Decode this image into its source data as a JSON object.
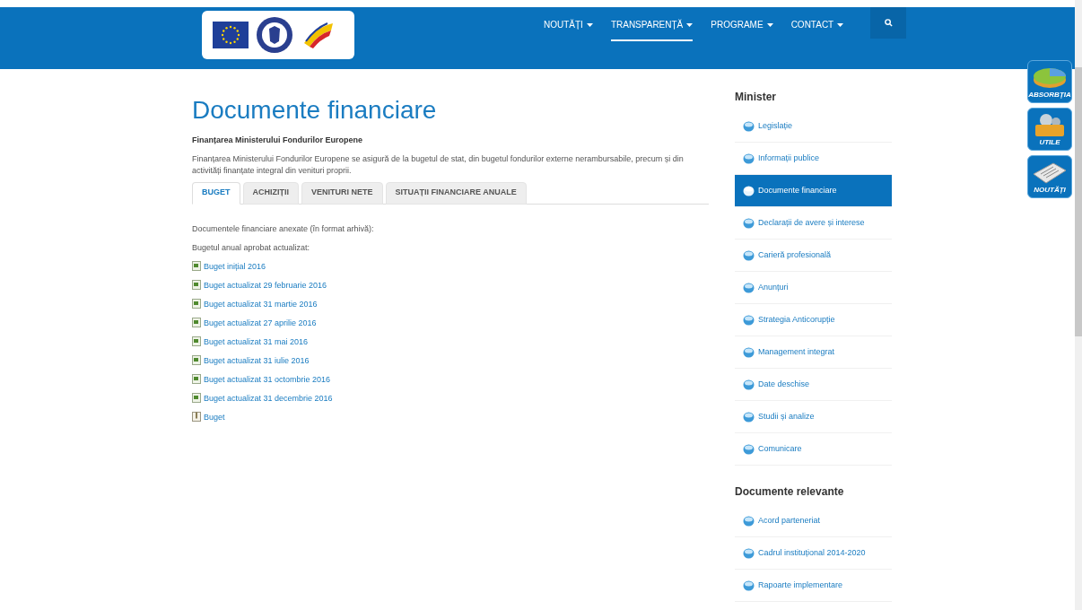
{
  "nav": [
    {
      "label": "NOUTĂȚI",
      "selected": false
    },
    {
      "label": "TRANSPARENȚĂ",
      "selected": true
    },
    {
      "label": "PROGRAME",
      "selected": false
    },
    {
      "label": "CONTACT",
      "selected": false
    }
  ],
  "title": "Documente financiare",
  "subtitle": "Finanțarea Ministerului Fondurilor Europene",
  "intro": "Finanțarea Ministerului Fondurilor Europene se asigură de la bugetul de stat, din bugetul fondurilor externe nerambursabile, precum și din activități finanțate integral din venituri proprii.",
  "tabs": [
    {
      "label": "BUGET",
      "selected": true
    },
    {
      "label": "ACHIZIȚII",
      "selected": false
    },
    {
      "label": "VENITURI NETE",
      "selected": false
    },
    {
      "label": "SITUAȚII FINANCIARE ANUALE",
      "selected": false
    }
  ],
  "notes": [
    "Documentele financiare anexate (în format arhivă):",
    "Bugetul anual aprobat actualizat:"
  ],
  "documents": [
    {
      "label": "Buget inițial 2016",
      "kind": "sheet"
    },
    {
      "label": "Buget actualizat 29 februarie 2016",
      "kind": "sheet"
    },
    {
      "label": "Buget actualizat 31 martie 2016",
      "kind": "sheet"
    },
    {
      "label": "Buget actualizat 27 aprilie 2016",
      "kind": "sheet"
    },
    {
      "label": "Buget actualizat 31 mai 2016",
      "kind": "sheet"
    },
    {
      "label": "Buget actualizat 31 iulie 2016",
      "kind": "sheet"
    },
    {
      "label": "Buget actualizat 31 octombrie 2016",
      "kind": "sheet"
    },
    {
      "label": "Buget actualizat 31 decembrie 2016",
      "kind": "sheet"
    },
    {
      "label": "Buget",
      "kind": "archive"
    }
  ],
  "sidebar": [
    {
      "heading": "Minister",
      "items": [
        {
          "label": "Legislație",
          "selected": false
        },
        {
          "label": "Informații publice",
          "selected": false
        },
        {
          "label": "Documente financiare",
          "selected": true
        },
        {
          "label": "Declarații de avere și interese",
          "selected": false
        },
        {
          "label": "Carieră profesională",
          "selected": false
        },
        {
          "label": "Anunțuri",
          "selected": false
        },
        {
          "label": "Strategia Anticorupție",
          "selected": false
        },
        {
          "label": "Management integrat",
          "selected": false
        },
        {
          "label": "Date deschise",
          "selected": false
        },
        {
          "label": "Studii și analize",
          "selected": false
        },
        {
          "label": "Comunicare",
          "selected": false
        }
      ]
    },
    {
      "heading": "Documente relevante",
      "items": [
        {
          "label": "Acord parteneriat",
          "selected": false
        },
        {
          "label": "Cadrul instituțional 2014-2020",
          "selected": false
        },
        {
          "label": "Rapoarte implementare",
          "selected": false
        }
      ]
    }
  ],
  "quick_links": [
    {
      "label": "ABSORBȚIA",
      "kind": "chart"
    },
    {
      "label": "UTILE",
      "kind": "folder"
    },
    {
      "label": "NOUTĂȚI",
      "kind": "newspaper"
    }
  ]
}
